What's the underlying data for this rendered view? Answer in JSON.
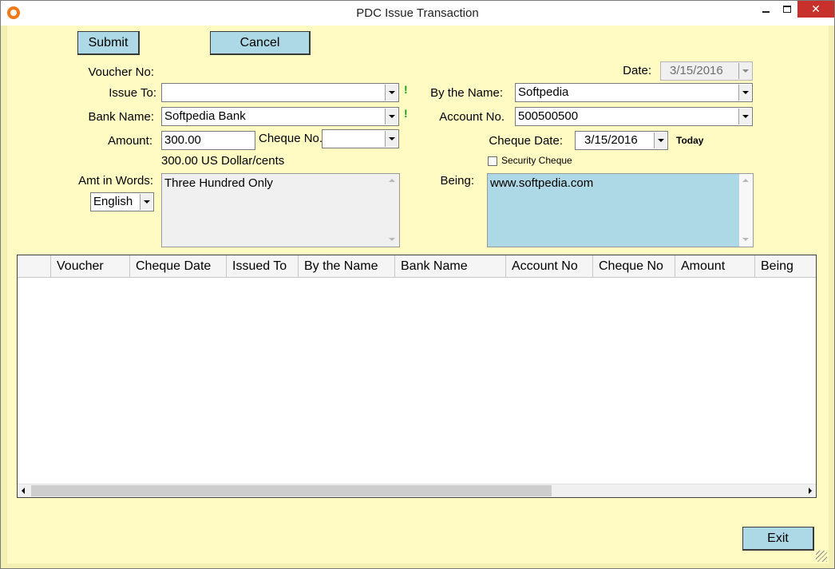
{
  "window": {
    "title": "PDC Issue Transaction"
  },
  "toolbar": {
    "submit_label": "Submit",
    "cancel_label": "Cancel",
    "exit_label": "Exit"
  },
  "form": {
    "voucher_label": "Voucher No:",
    "issue_to_label": "Issue To:",
    "issue_to_value": "",
    "bank_name_label": "Bank Name:",
    "bank_name_value": "Softpedia Bank",
    "amount_label": "Amount:",
    "amount_value": "300.00",
    "cheque_no_label": "Cheque No.",
    "cheque_no_value": "",
    "amount_text": "300.00 US Dollar/cents",
    "amt_words_label": "Amt in Words:",
    "language_value": "English",
    "amt_words_value": "Three Hundred Only",
    "date_label": "Date:",
    "date_value": "3/15/2016",
    "by_name_label": "By the Name:",
    "by_name_value": "Softpedia",
    "account_no_label": "Account No.",
    "account_no_value": "500500500",
    "cheque_date_label": "Cheque Date:",
    "cheque_date_value": "3/15/2016",
    "today_label": "Today",
    "security_cheque_label": "Security Cheque",
    "security_cheque_checked": false,
    "being_label": "Being:",
    "being_value": "www.softpedia.com",
    "required_mark": "!"
  },
  "grid": {
    "columns": [
      "",
      "Voucher",
      "Cheque Date",
      "Issued To",
      "By the Name",
      "Bank Name",
      "Account No",
      "Cheque No",
      "Amount",
      "Being"
    ],
    "rows": []
  },
  "colors": {
    "background": "#fffbc2",
    "button": "#add8e6",
    "being_box": "#add8e6",
    "required_mark": "#1a9a1a",
    "close_button": "#c7302b"
  }
}
